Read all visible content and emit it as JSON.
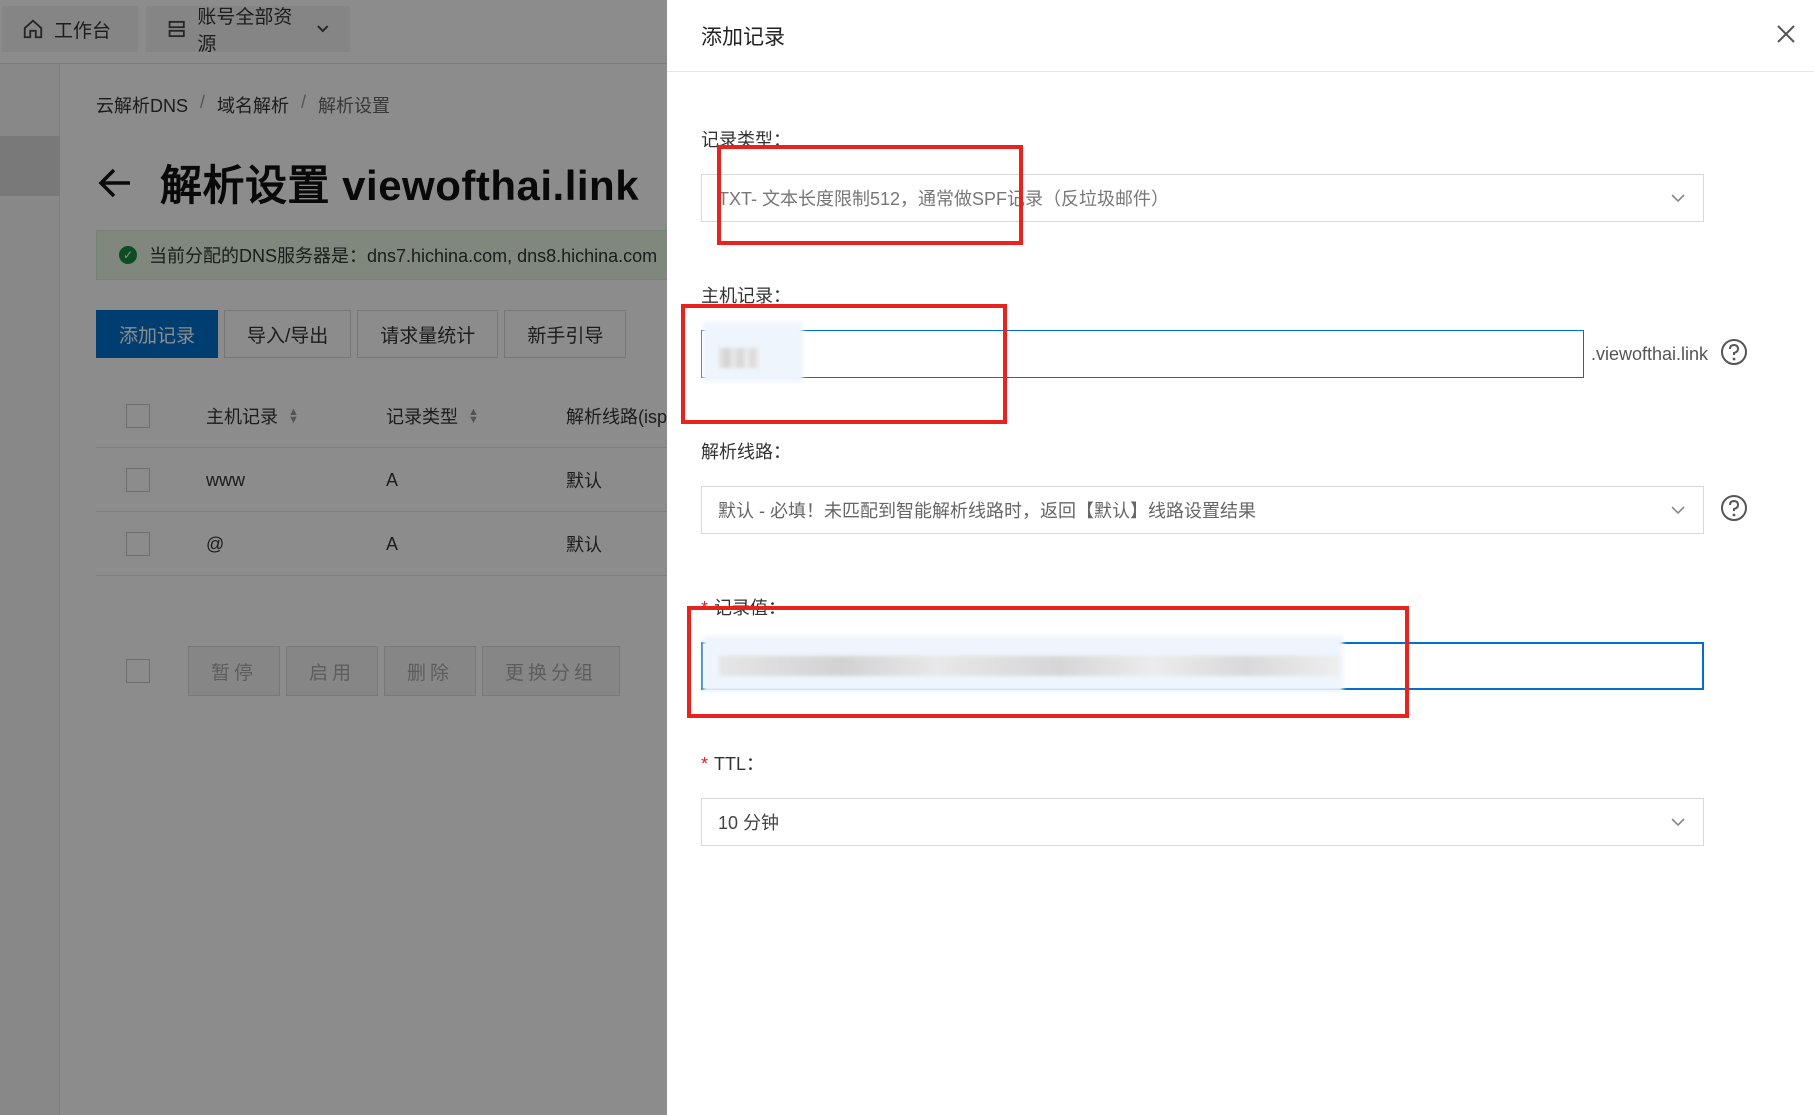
{
  "topbar": {
    "workbench_label": "工作台",
    "resources_label": "账号全部资源"
  },
  "breadcrumb": {
    "items": [
      "云解析DNS",
      "域名解析",
      "解析设置"
    ],
    "separator": "/"
  },
  "page": {
    "title": "解析设置 viewofthai.link"
  },
  "notice": {
    "text": "当前分配的DNS服务器是：dns7.hichina.com, dns8.hichina.com"
  },
  "toolbar": {
    "add_label": "添加记录",
    "import_export_label": "导入/导出",
    "stats_label": "请求量统计",
    "guide_label": "新手引导"
  },
  "table": {
    "headers": [
      "主机记录",
      "记录类型",
      "解析线路(isp)"
    ],
    "rows": [
      {
        "host": "www",
        "type": "A",
        "line": "默认"
      },
      {
        "host": "@",
        "type": "A",
        "line": "默认"
      }
    ]
  },
  "bulk": {
    "pause_label": "暂停",
    "enable_label": "启用",
    "delete_label": "删除",
    "group_label": "更换分组"
  },
  "drawer": {
    "title": "添加记录",
    "record_type_label": "记录类型：",
    "record_type_value": "TXT- 文本长度限制512，通常做SPF记录（反垃圾邮件）",
    "host_label": "主机记录：",
    "host_suffix": ".viewofthai.link",
    "line_label": "解析线路：",
    "line_value": "默认 - 必填！未匹配到智能解析线路时，返回【默认】线路设置结果",
    "value_label": "记录值：",
    "ttl_label": "TTL：",
    "ttl_value": "10 分钟",
    "required_mark": "*"
  },
  "colors": {
    "primary": "#0070cc",
    "annotation": "#e8221d",
    "success": "#1b8a3c"
  }
}
